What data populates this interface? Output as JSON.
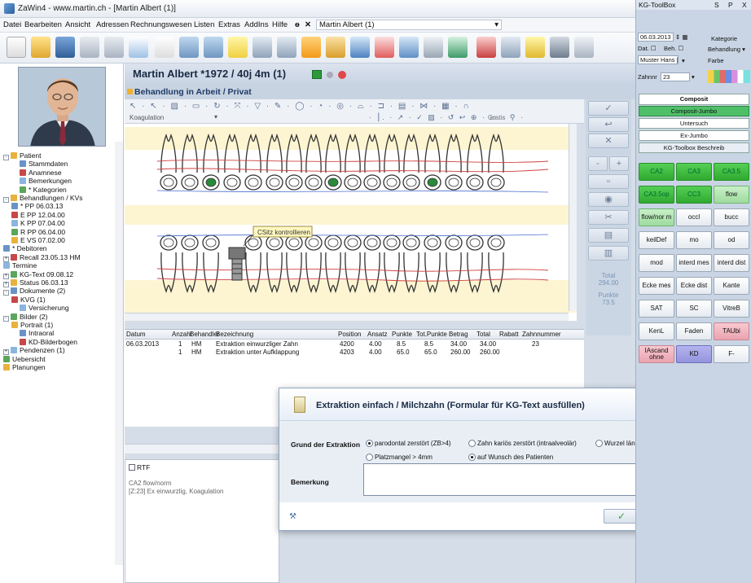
{
  "window": {
    "title": "ZaWin4 - www.martin.ch - [Martin Albert (1)]"
  },
  "menu": {
    "items": [
      "Datei",
      "Bearbeiten",
      "Ansicht",
      "Adressen",
      "Rechnungswesen",
      "Listen",
      "Extras",
      "AddIns",
      "Hilfe"
    ],
    "doc_dropdown": "Martin Albert (1)"
  },
  "patient": {
    "header": "Martin Albert *1972 / 40j 4m (1)",
    "subheader": "Behandlung in Arbeit / Privat"
  },
  "drawing_toolbar": {
    "mode": "Koagulation",
    "gratis": "Gratis"
  },
  "tooth_chart": {
    "callout": "CSitz kontrollieren"
  },
  "tree": {
    "items": [
      {
        "label": "Patient",
        "level": 0,
        "expander": "-"
      },
      {
        "label": "Stammdaten",
        "level": 2
      },
      {
        "label": "Anamnese",
        "level": 2
      },
      {
        "label": "Bemerkungen",
        "level": 2
      },
      {
        "label": "* Kategorien",
        "level": 2
      },
      {
        "label": "Behandlungen / KVs",
        "level": 0,
        "expander": "-"
      },
      {
        "label": "* PP 06.03.13",
        "level": 1
      },
      {
        "label": "E PP 12.04.00",
        "level": 1
      },
      {
        "label": "K PP 07.04.00",
        "level": 1
      },
      {
        "label": "R PP 06.04.00",
        "level": 1
      },
      {
        "label": "E VS 07.02.00",
        "level": 1
      },
      {
        "label": "* Debitoren",
        "level": 0
      },
      {
        "label": "Recall 23.05.13 HM",
        "level": 0,
        "expander": "+"
      },
      {
        "label": "Termine",
        "level": 0
      },
      {
        "label": "KG-Text 09.08.12",
        "level": 0,
        "expander": "+"
      },
      {
        "label": "Status 06.03.13",
        "level": 0,
        "expander": "+"
      },
      {
        "label": "Dokumente (2)",
        "level": 0,
        "expander": "-"
      },
      {
        "label": "KVG (1)",
        "level": 1
      },
      {
        "label": "Versicherung",
        "level": 2
      },
      {
        "label": "Bilder (2)",
        "level": 0,
        "expander": "-"
      },
      {
        "label": "Portrait (1)",
        "level": 1
      },
      {
        "label": "Intraoral",
        "level": 2
      },
      {
        "label": "KD-Bilderbogen",
        "level": 2
      },
      {
        "label": "Pendenzen (1)",
        "level": 0,
        "expander": "+"
      },
      {
        "label": "Uebersicht",
        "level": 0
      },
      {
        "label": "Planungen",
        "level": 0
      }
    ]
  },
  "totals": {
    "total_label": "Total",
    "total_value": "294.00",
    "punkte_label": "Punkte",
    "punkte_value": "73.5"
  },
  "table": {
    "columns": [
      "Datum",
      "Anzahl",
      "Behandler",
      "Bezeichnung",
      "Position",
      "Ansatz",
      "Punkte",
      "Tot.Punkte",
      "Betrag",
      "Total",
      "Rabatt",
      "Zahnnummer"
    ],
    "rows": [
      [
        "06.03.2013",
        "1",
        "HM",
        "Extraktion einwurzliger Zahn",
        "4200",
        "4.00",
        "8.5",
        "8.5",
        "34.00",
        "34.00",
        "",
        "23"
      ],
      [
        "",
        "1",
        "HM",
        "Extraktion unter Aufklappung",
        "4203",
        "4.00",
        "65.0",
        "65.0",
        "260.00",
        "260.00",
        "",
        ""
      ]
    ]
  },
  "rtf": {
    "label": "RTF",
    "line1": "CA2 flow/norm",
    "line2": "[Z:23] Ex einwurzlig, Koagulation"
  },
  "dialog": {
    "title": "Extraktion einfach / Milchzahn (Formular für KG-Text ausfüllen)",
    "grund_label": "Grund der Extraktion",
    "options": [
      {
        "label": "parodontal zerstört (ZB>4)",
        "checked": true
      },
      {
        "label": "Zahn kariös zerstört (intraalveolär)",
        "checked": false
      },
      {
        "label": "Wurzel längsfrakturiert",
        "checked": false
      },
      {
        "label": "Platzmangel > 4mm",
        "checked": false
      },
      {
        "label": "auf Wunsch des Patienten",
        "checked": true
      }
    ],
    "bemerkung_label": "Bemerkung",
    "bemerkung_value": ""
  },
  "toolbox": {
    "title": "KG-ToolBox",
    "tabs": [
      "S",
      "P",
      "X"
    ],
    "date": "06.03.2013",
    "kategorie_label": "Kategorie",
    "dat_label": "Dat.",
    "beh_label": "Beh.",
    "behandlung_label": "Behandlung",
    "muster": "Muster Hans [Chi",
    "farbe_label": "Farbe",
    "zahn_label": "Zahnnr",
    "zahn_value": "23",
    "composit_header": "Composit",
    "list": [
      "Composit-Jumbo",
      "Untersuch",
      "Ex-Jumbo",
      "KG-Toolbox Beschreib"
    ],
    "keys": [
      {
        "label": "CA2",
        "style": "green"
      },
      {
        "label": "CA3",
        "style": "green"
      },
      {
        "label": "CA3.5",
        "style": "green"
      },
      {
        "label": "CA3.5op",
        "style": "green"
      },
      {
        "label": "CC3",
        "style": "green"
      },
      {
        "label": "flow",
        "style": "lgreen"
      },
      {
        "label": "flow/nor m",
        "style": "lgreen"
      },
      {
        "label": "occl",
        "style": ""
      },
      {
        "label": "bucc",
        "style": ""
      },
      {
        "label": "keilDef",
        "style": ""
      },
      {
        "label": "mo",
        "style": ""
      },
      {
        "label": "od",
        "style": ""
      },
      {
        "label": "mod",
        "style": ""
      },
      {
        "label": "interd mes",
        "style": ""
      },
      {
        "label": "interd dist",
        "style": ""
      },
      {
        "label": "Ecke mes",
        "style": ""
      },
      {
        "label": "Ecke dist",
        "style": ""
      },
      {
        "label": "Kante",
        "style": ""
      },
      {
        "label": "SAT",
        "style": ""
      },
      {
        "label": "SC",
        "style": ""
      },
      {
        "label": "VitreB",
        "style": ""
      },
      {
        "label": "KenL",
        "style": ""
      },
      {
        "label": "Faden",
        "style": ""
      },
      {
        "label": "TAUbi",
        "style": "pink"
      },
      {
        "label": "IAscand ohne",
        "style": "pink"
      },
      {
        "label": "KD",
        "style": "violet"
      },
      {
        "label": "F-",
        "style": ""
      }
    ]
  }
}
